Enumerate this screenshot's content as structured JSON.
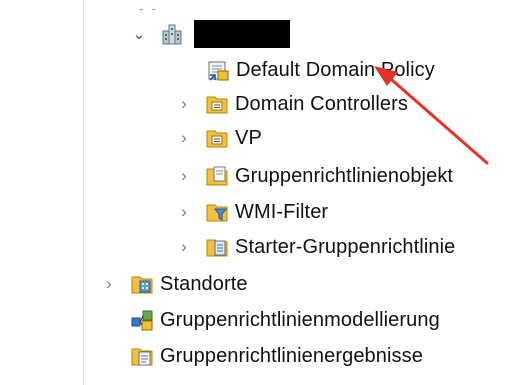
{
  "tree": {
    "domain_row": {
      "expander": "expanded",
      "icon": "domain-icon",
      "name_redacted": true
    },
    "children": [
      {
        "label": "Default Domain Policy",
        "icon": "policy-link-icon",
        "expander": "none"
      },
      {
        "label": "Domain Controllers",
        "icon": "ou-folder-icon",
        "expander": "collapsed"
      },
      {
        "label": "VP",
        "icon": "ou-folder-icon",
        "expander": "collapsed"
      },
      {
        "label": "Gruppenrichtlinienobjekt",
        "icon": "gpo-folder-icon",
        "expander": "collapsed"
      },
      {
        "label": "WMI-Filter",
        "icon": "wmi-filter-folder-icon",
        "expander": "collapsed"
      },
      {
        "label": "Starter-Gruppenrichtlinie",
        "icon": "starter-gpo-folder-icon",
        "expander": "collapsed"
      }
    ],
    "top_level": [
      {
        "label": "Standorte",
        "icon": "sites-icon",
        "expander": "collapsed"
      },
      {
        "label": "Gruppenrichtlinienmodellierung",
        "icon": "modeling-icon",
        "expander": "none"
      },
      {
        "label": "Gruppenrichtlinienergebnisse",
        "icon": "results-icon",
        "expander": "none"
      }
    ]
  },
  "annotation": {
    "color": "#e8302a"
  },
  "colors": {
    "folder": "#e8b931",
    "selection_border": "#cfcfcf"
  }
}
